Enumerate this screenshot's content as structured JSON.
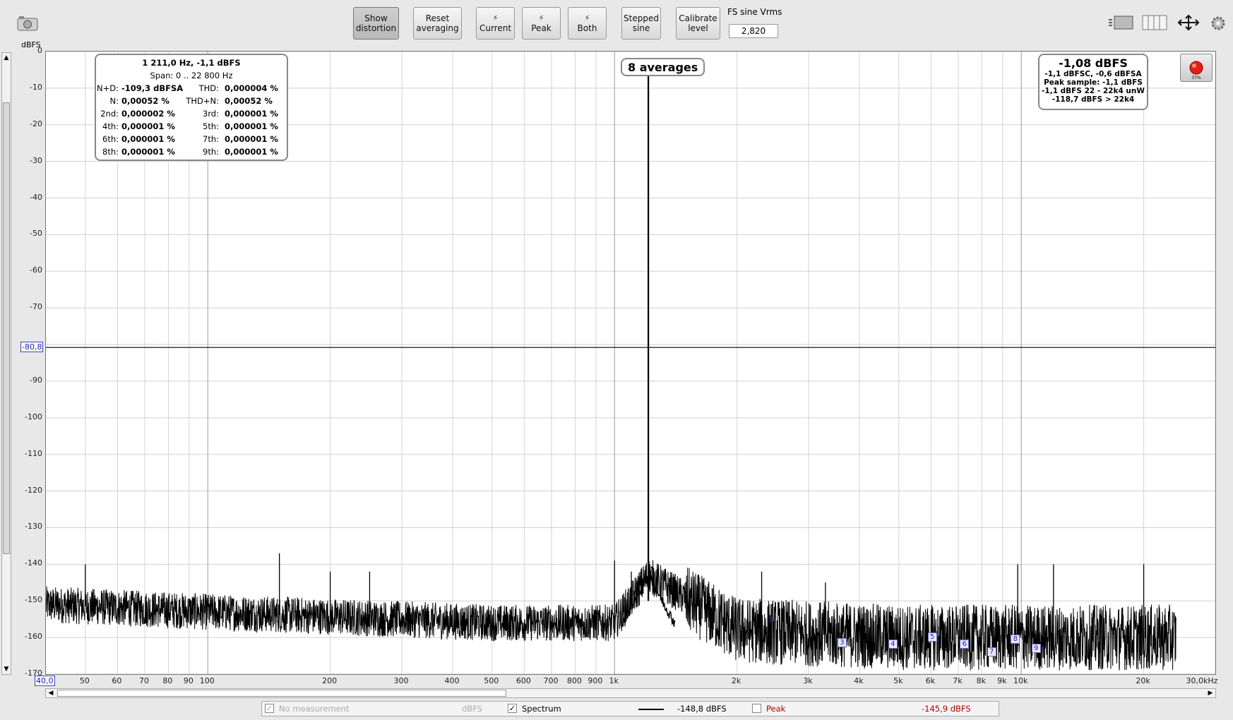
{
  "toolbar": {
    "show_distortion_l1": "Show",
    "show_distortion_l2": "distortion",
    "reset_averaging_l1": "Reset",
    "reset_averaging_l2": "averaging",
    "current_label": "Current",
    "peak_label": "Peak",
    "both_label": "Both",
    "stepped_sine_l1": "Stepped",
    "stepped_sine_l2": "sine",
    "calibrate_level_l1": "Calibrate",
    "calibrate_level_l2": "level",
    "fs_sine_label": "FS sine Vrms",
    "fs_sine_value": "2,820"
  },
  "axis": {
    "y_unit": "dBFS",
    "y_ticks": [
      "0",
      "-10",
      "-20",
      "-30",
      "-40",
      "-50",
      "-60",
      "-70",
      "-90",
      "-100",
      "-110",
      "-120",
      "-130",
      "-140",
      "-150",
      "-160",
      "-170"
    ],
    "y_cursor_value": "-80,8",
    "x_start_value": "40,0",
    "x_ticks": [
      "50",
      "60",
      "70",
      "80",
      "90",
      "100",
      "200",
      "300",
      "400",
      "500",
      "600",
      "700",
      "800",
      "900",
      "1k",
      "2k",
      "3k",
      "4k",
      "5k",
      "6k",
      "7k",
      "8k",
      "9k",
      "10k",
      "20k",
      "30,0kHz"
    ]
  },
  "distortion": {
    "header": "1 211,0 Hz, -1,1 dBFS",
    "span": "Span: 0 .. 22 800 Hz",
    "rows": [
      {
        "k1": "N+D:",
        "v1": "-109,3 dBFSA",
        "k2": "THD:",
        "v2": "0,000004 %"
      },
      {
        "k1": "N:",
        "v1": "0,00052 %",
        "k2": "THD+N:",
        "v2": "0,00052 %"
      },
      {
        "k1": "2nd:",
        "v1": "0,000002 %",
        "k2": "3rd:",
        "v2": "0,000001 %"
      },
      {
        "k1": "4th:",
        "v1": "0,000001 %",
        "k2": "5th:",
        "v2": "0,000001 %"
      },
      {
        "k1": "6th:",
        "v1": "0,000001 %",
        "k2": "7th:",
        "v2": "0,000001 %"
      },
      {
        "k1": "8th:",
        "v1": "0,000001 %",
        "k2": "9th:",
        "v2": "0,000001 %"
      }
    ]
  },
  "averages_label": "8 averages",
  "level": {
    "main": "-1,08 dBFS",
    "line1": "-1,1 dBFSC, -0,6 dBFSA",
    "line2": "Peak sample: -1,1 dBFS",
    "line3": "-1,1 dBFS 22 - 22k4 unW",
    "line4": "-118,7 dBFS > 22k4"
  },
  "record_percent": "37%",
  "harmonic_markers": [
    "2",
    "3",
    "4",
    "5",
    "6",
    "7",
    "8",
    "9"
  ],
  "legend": {
    "no_measurement": "No measurement",
    "unit": "dBFS",
    "spectrum_label": "Spectrum",
    "spectrum_value": "-148,8 dBFS",
    "peak_label": "Peak",
    "peak_value": "-145,9 dBFS",
    "peak_color": "#b00000"
  },
  "chart_data": {
    "type": "line",
    "xscale": "log",
    "xlim": [
      40,
      30000
    ],
    "ylim": [
      -170,
      0
    ],
    "grid": true,
    "ylabel": "dBFS",
    "fundamental_hz": 1211,
    "fundamental_dbfs": -1.1,
    "cursor_dbfs": -80.8,
    "noise_floor": {
      "x": [
        40,
        100,
        500,
        1000,
        1211,
        2000,
        5000,
        10000,
        24000
      ],
      "y": [
        -151,
        -153,
        -156,
        -156,
        -143,
        -158,
        -160,
        -160,
        -160
      ]
    },
    "spurs": {
      "x": [
        50,
        150,
        200,
        250,
        1000,
        1100,
        1400,
        2300,
        3300,
        9800,
        12000,
        20000
      ],
      "y": [
        -140,
        -137,
        -142,
        -142,
        -139,
        -142,
        -145,
        -142,
        -145,
        -140,
        -140,
        -140
      ]
    }
  }
}
